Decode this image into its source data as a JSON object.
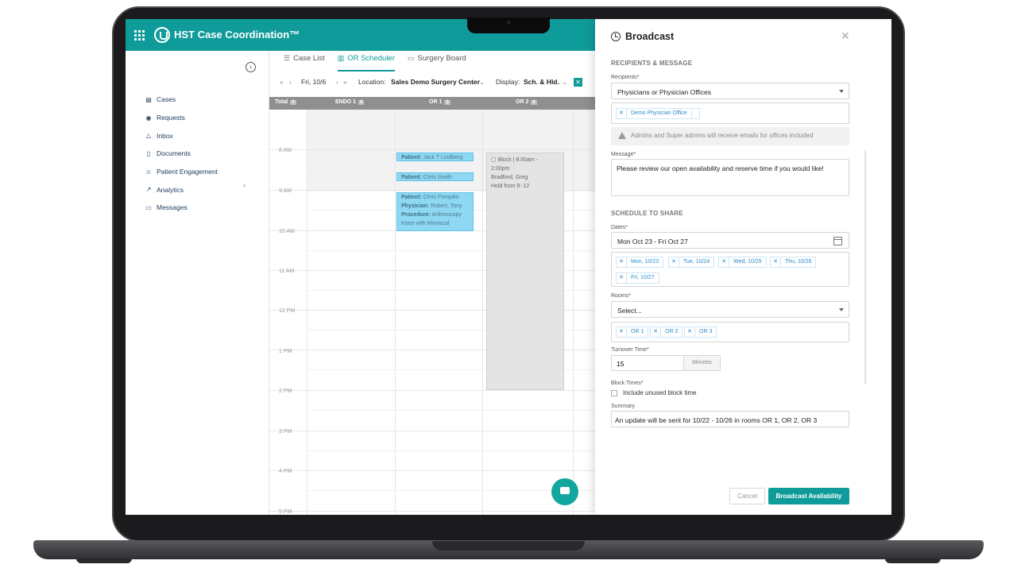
{
  "app": {
    "title": "HST Case Coordination™"
  },
  "sidebar": {
    "items": [
      {
        "label": "Cases",
        "icon": "briefcase-icon"
      },
      {
        "label": "Requests",
        "icon": "check-circle-icon"
      },
      {
        "label": "Inbox",
        "icon": "inbox-icon"
      },
      {
        "label": "Documents",
        "icon": "document-icon"
      },
      {
        "label": "Patient Engagement",
        "icon": "user-icon"
      },
      {
        "label": "Analytics",
        "icon": "chart-icon"
      },
      {
        "label": "Messages",
        "icon": "message-icon"
      }
    ]
  },
  "tabs": [
    {
      "label": "Case List",
      "icon": "list-icon"
    },
    {
      "label": "OR Scheduler",
      "icon": "columns-icon",
      "active": true
    },
    {
      "label": "Surgery Board",
      "icon": "monitor-icon"
    }
  ],
  "toolbar": {
    "date": "Fri, 10/6",
    "location_label": "Location:",
    "location_value": "Sales Demo Surgery Center",
    "display_label": "Display:",
    "display_value": "Sch. & Hld."
  },
  "calendar": {
    "columns": [
      {
        "label": "Total",
        "count": "3"
      },
      {
        "label": "ENDO 1",
        "count": "0"
      },
      {
        "label": "OR 1",
        "count": "3"
      },
      {
        "label": "OR 2",
        "count": "0"
      }
    ],
    "times": [
      "8 AM",
      "9 AM",
      "10 AM",
      "11 AM",
      "12 PM",
      "1 PM",
      "2 PM",
      "3 PM",
      "4 PM",
      "5 PM"
    ],
    "events": [
      {
        "label1": "Patient:",
        "value1": "Jack T Lindberg"
      },
      {
        "label1": "Patient:",
        "value1": "Chris Smith"
      },
      {
        "label1": "Patient:",
        "value1": "Chris Pompilio",
        "label2": "Physician:",
        "value2": "Robert, Tony",
        "label3": "Procedure:",
        "value3": "Arthroscopy Knee with Meniscal"
      }
    ],
    "block": {
      "line1": "Block | 8:00am -",
      "line2": "2:00pm",
      "line3": "Bradford, Greg",
      "line4": "Hold from 9- 12"
    }
  },
  "broadcast": {
    "title": "Broadcast",
    "section1": "RECIPIENTS & MESSAGE",
    "recipients_label": "Recipients*",
    "recipients_value": "Physicians or Physician Offices",
    "recipient_chips": [
      "Demo Physician Office"
    ],
    "note": "Admins and Super admins will receive emails for offices included",
    "message_label": "Message*",
    "message_value": "Please review our open availability and reserve time if you would like!",
    "section2": "SCHEDULE TO SHARE",
    "dates_label": "Dates*",
    "dates_value": "Mon Oct 23 - Fri Oct 27",
    "date_chips": [
      "Mon, 10/23",
      "Tue, 10/24",
      "Wed, 10/25",
      "Thu, 10/26",
      "Fri, 10/27"
    ],
    "rooms_label": "Rooms*",
    "rooms_placeholder": "Select...",
    "room_chips": [
      "OR 1",
      "OR 2",
      "OR 3"
    ],
    "turnover_label": "Turnover Time*",
    "turnover_value": "15",
    "turnover_unit": "Minutes",
    "block_times_label": "Block Times*",
    "block_checkbox_label": "Include unused block time",
    "summary_label": "Summary",
    "summary_value": "An update will be sent for 10/22 - 10/26 in rooms OR 1, OR 2, OR 3",
    "cancel_label": "Cancel",
    "submit_label": "Broadcast Availability"
  }
}
